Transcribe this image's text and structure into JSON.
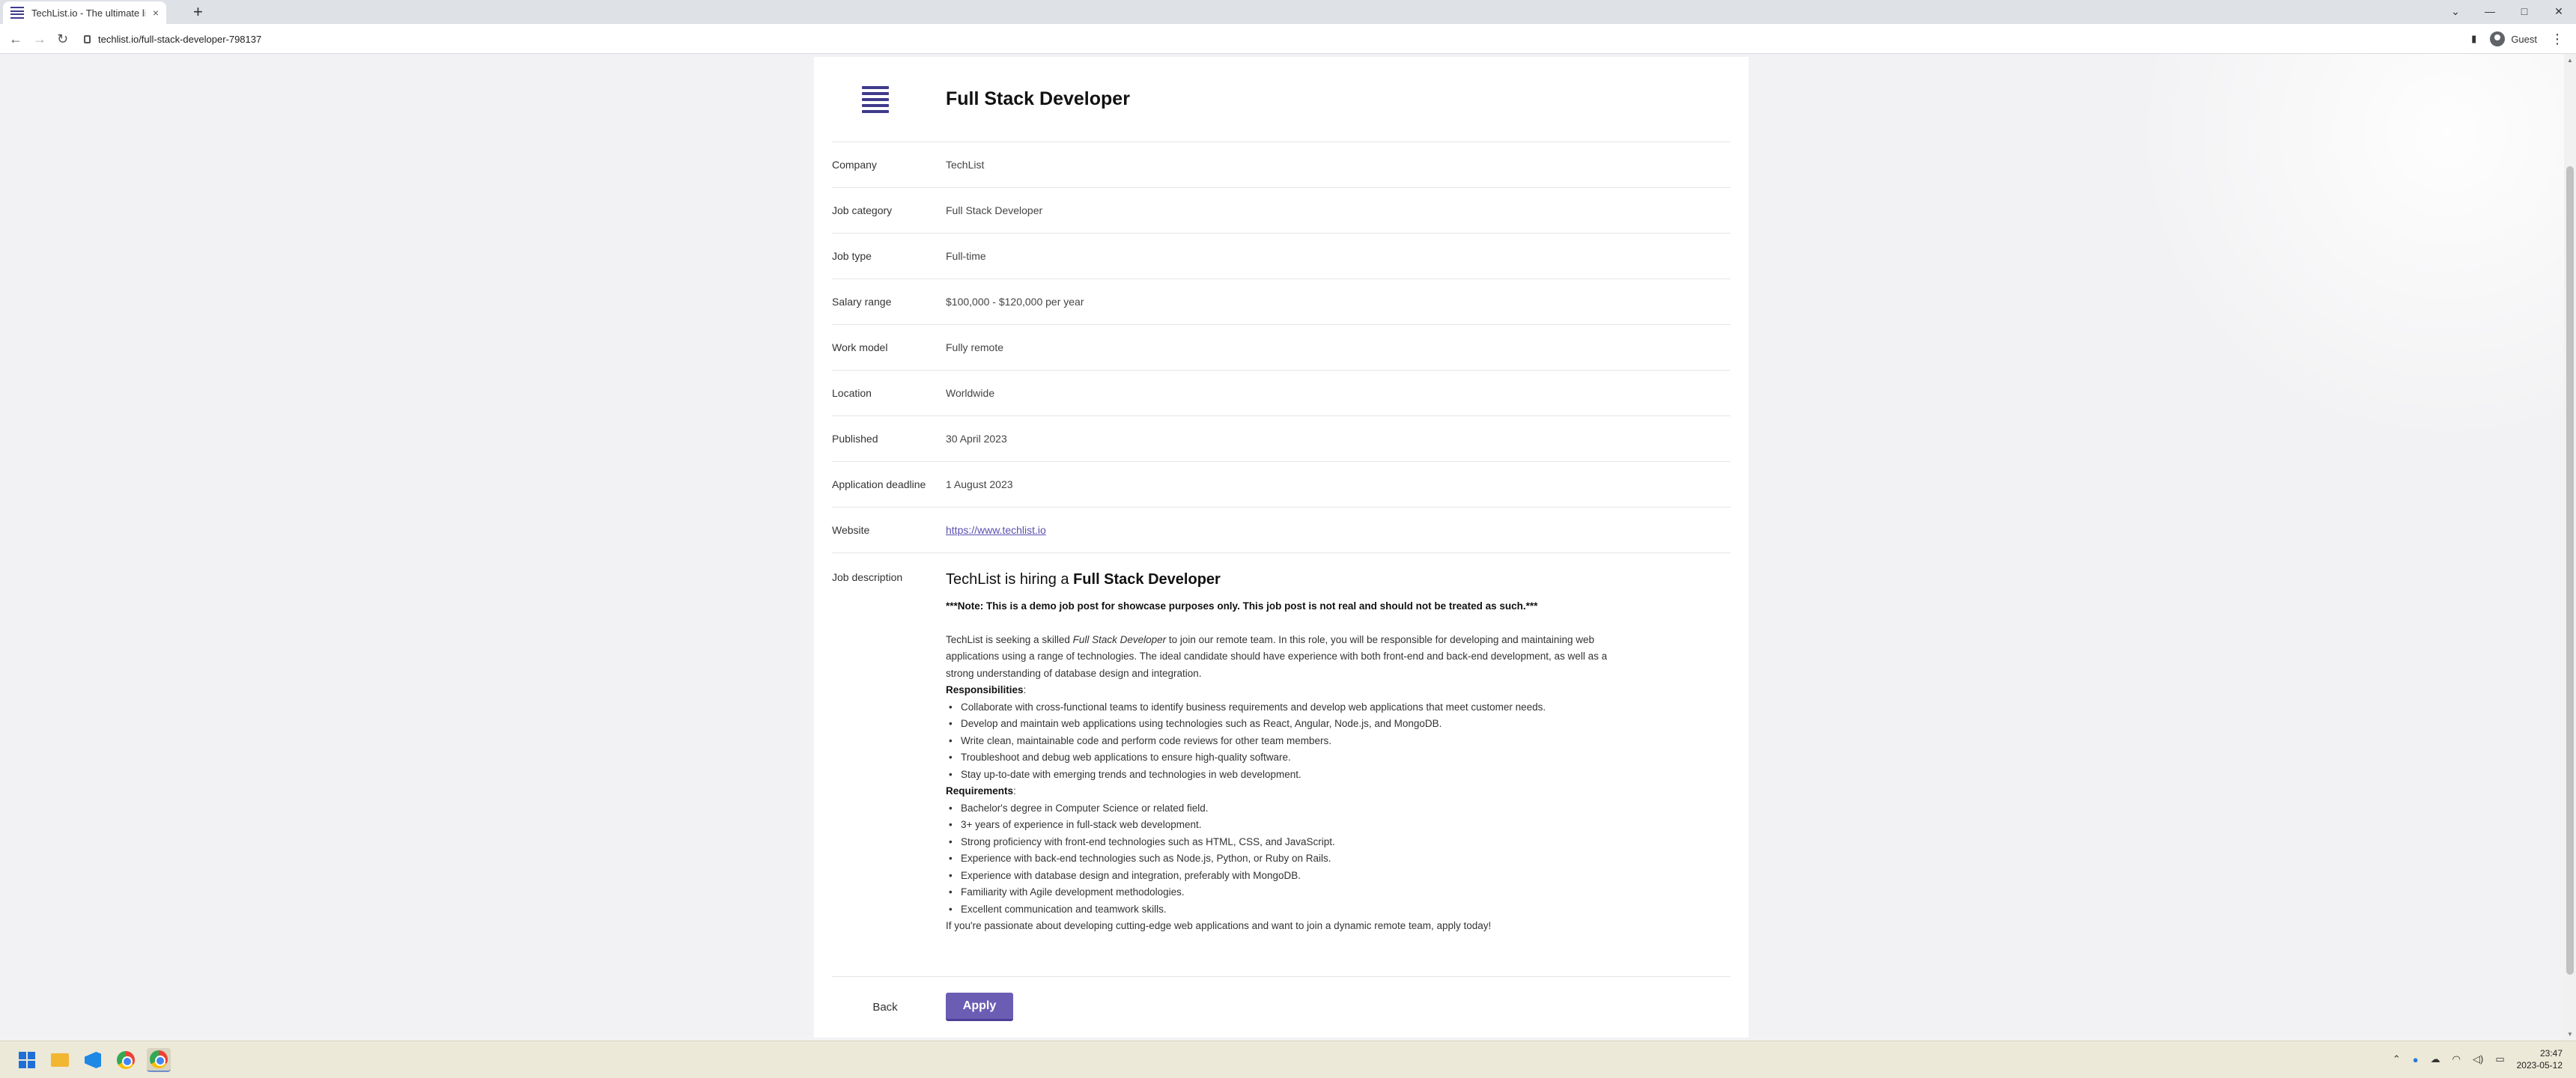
{
  "browser": {
    "tab_title": "TechList.io - The ultimate list for",
    "tab_close": "×",
    "new_tab": "+",
    "url": "techlist.io/full-stack-developer-798137",
    "profile": "Guest",
    "nav_back": "←",
    "nav_forward": "→",
    "nav_reload": "↻",
    "win_min": "—",
    "win_max": "□",
    "win_close": "✕",
    "tab_search": "⌄",
    "menu": "⋮",
    "sidepanel": "▮"
  },
  "job": {
    "title": "Full Stack Developer",
    "fields": [
      {
        "label": "Company",
        "value": "TechList"
      },
      {
        "label": "Job category",
        "value": "Full Stack Developer"
      },
      {
        "label": "Job type",
        "value": "Full-time"
      },
      {
        "label": "Salary range",
        "value": "$100,000 - $120,000 per year"
      },
      {
        "label": "Work model",
        "value": "Fully remote"
      },
      {
        "label": "Location",
        "value": "Worldwide"
      },
      {
        "label": "Published",
        "value": "30 April 2023"
      },
      {
        "label": "Application deadline",
        "value": "1 August 2023"
      },
      {
        "label": "Website",
        "value": "https://www.techlist.io"
      }
    ],
    "description_label": "Job description",
    "description": {
      "heading_prefix": "TechList is hiring a ",
      "heading_role": "Full Stack Developer",
      "note": "***Note: This is a demo job post for showcase purposes only. This job post is not real and should not be treated as such.***",
      "intro_prefix": "TechList is seeking a skilled ",
      "intro_role": "Full Stack Developer",
      "intro_rest": " to join our remote team. In this role, you will be responsible for developing and maintaining web applications using a range of technologies. The ideal candidate should have experience with both front-end and back-end development, as well as a strong understanding of database design and integration.",
      "responsibilities_title": "Responsibilities",
      "responsibilities": [
        "Collaborate with cross-functional teams to identify business requirements and develop web applications that meet customer needs.",
        "Develop and maintain web applications using technologies such as React, Angular, Node.js, and MongoDB.",
        "Write clean, maintainable code and perform code reviews for other team members.",
        "Troubleshoot and debug web applications to ensure high-quality software.",
        "Stay up-to-date with emerging trends and technologies in web development."
      ],
      "requirements_title": "Requirements",
      "requirements": [
        "Bachelor's degree in Computer Science or related field.",
        "3+ years of experience in full-stack web development.",
        "Strong proficiency with front-end technologies such as HTML, CSS, and JavaScript.",
        "Experience with back-end technologies such as Node.js, Python, or Ruby on Rails.",
        "Experience with database design and integration, preferably with MongoDB.",
        "Familiarity with Agile development methodologies.",
        "Excellent communication and teamwork skills."
      ],
      "closing": "If you're passionate about developing cutting-edge web applications and want to join a dynamic remote team, apply today!"
    },
    "back_label": "Back",
    "apply_label": "Apply"
  },
  "taskbar": {
    "time": "23:47",
    "date": "2023-05-12",
    "tray_chevron": "⌃",
    "tray_wifi": "◠",
    "tray_volume": "◁)",
    "tray_battery": "▭"
  },
  "colors": {
    "accent": "#6b5db4",
    "brand": "#3f3a8c"
  }
}
